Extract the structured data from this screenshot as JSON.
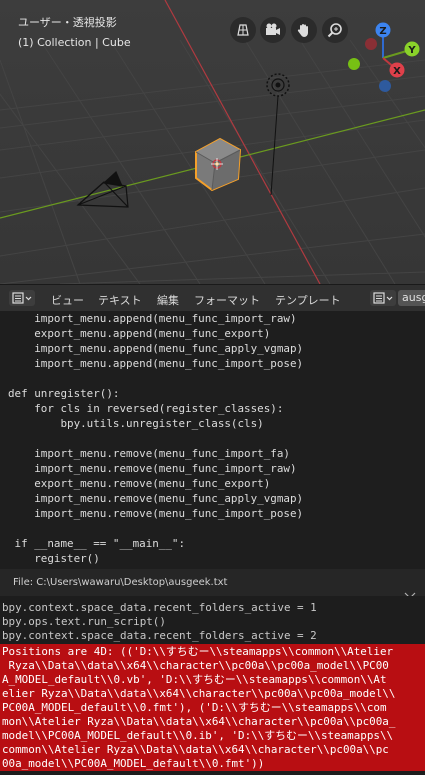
{
  "viewport": {
    "title": "ユーザー・透視投影",
    "subtitle": "(1) Collection | Cube",
    "gizmo": {
      "z": "Z",
      "y": "Y",
      "x": "X"
    },
    "colors": {
      "x_axis": "#c0383f",
      "y_axis": "#6a9a1f",
      "cube_outline": "#f5a02a"
    }
  },
  "text_editor": {
    "menus": [
      "ビュー",
      "テキスト",
      "編集",
      "フォーマット",
      "テンプレート"
    ],
    "text_name": "ausg",
    "code_lines": [
      "    import_menu.append(menu_func_import_raw)",
      "    export_menu.append(menu_func_export)",
      "    import_menu.append(menu_func_apply_vgmap)",
      "    import_menu.append(menu_func_import_pose)",
      "",
      "def unregister():",
      "    for cls in reversed(register_classes):",
      "        bpy.utils.unregister_class(cls)",
      "",
      "    import_menu.remove(menu_func_import_fa)",
      "    import_menu.remove(menu_func_import_raw)",
      "    export_menu.remove(menu_func_export)",
      "    import_menu.remove(menu_func_apply_vgmap)",
      "    import_menu.remove(menu_func_import_pose)",
      "",
      " if __name__ == \"__main__\":",
      "    register()"
    ],
    "file_path": "File: C:\\Users\\wawaru\\Desktop\\ausgeek.txt"
  },
  "console": {
    "lines": [
      "bpy.context.space_data.recent_folders_active = 1",
      "bpy.ops.text.run_script()",
      "bpy.context.space_data.recent_folders_active = 2"
    ],
    "error_lines": [
      "Positions are 4D: (('D:\\\\すちむー\\\\steamapps\\\\common\\\\Atelier",
      " Ryza\\\\Data\\\\data\\\\x64\\\\character\\\\pc00a\\\\pc00a_model\\\\PC00",
      "A_MODEL_default\\\\0.vb', 'D:\\\\すちむー\\\\steamapps\\\\common\\\\At",
      "elier Ryza\\\\Data\\\\data\\\\x64\\\\character\\\\pc00a\\\\pc00a_model\\\\",
      "PC00A_MODEL_default\\\\0.fmt'), ('D:\\\\すちむー\\\\steamapps\\\\com",
      "mon\\\\Atelier Ryza\\\\Data\\\\data\\\\x64\\\\character\\\\pc00a\\\\pc00a_",
      "model\\\\PC00A_MODEL_default\\\\0.ib', 'D:\\\\すちむー\\\\steamapps\\\\",
      "common\\\\Atelier Ryza\\\\Data\\\\data\\\\x64\\\\character\\\\pc00a\\\\pc",
      "00a_model\\\\PC00A_MODEL_default\\\\0.fmt'))"
    ],
    "error_color": "#b80e12"
  }
}
